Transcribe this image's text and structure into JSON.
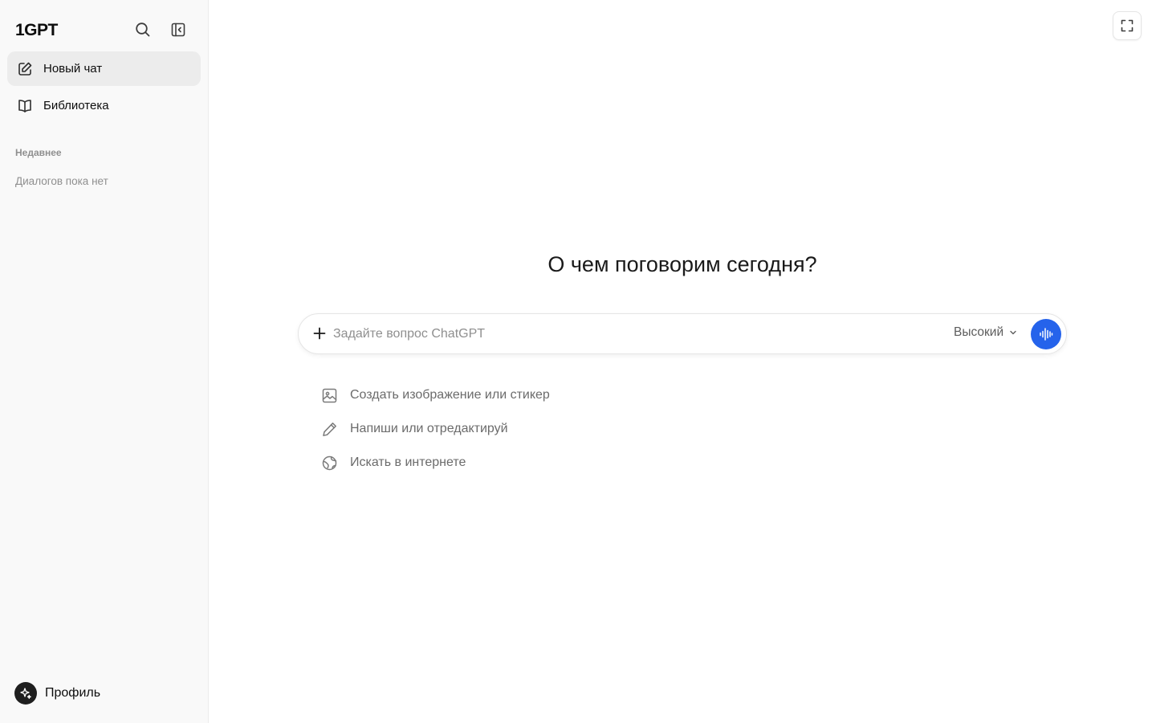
{
  "app": {
    "brand": "1GPT"
  },
  "sidebar": {
    "icons": {
      "search": "search-icon",
      "collapse": "sidebar-collapse-icon"
    },
    "items": [
      {
        "label": "Новый чат",
        "icon": "edit-icon"
      },
      {
        "label": "Библиотека",
        "icon": "book-icon"
      }
    ],
    "recent_label": "Недавнее",
    "empty_text": "Диалогов пока нет",
    "profile_label": "Профиль"
  },
  "main": {
    "headline": "О чем поговорим сегодня?",
    "composer": {
      "placeholder": "Задайте вопрос ChatGPT",
      "model_value": "Высокий",
      "voice_color": "#2563eb"
    },
    "suggestions": [
      {
        "label": "Создать изображение или стикер",
        "icon": "image-icon"
      },
      {
        "label": "Напиши или отредактируй",
        "icon": "pencil-icon"
      },
      {
        "label": "Искать в интернете",
        "icon": "globe-icon"
      }
    ]
  }
}
